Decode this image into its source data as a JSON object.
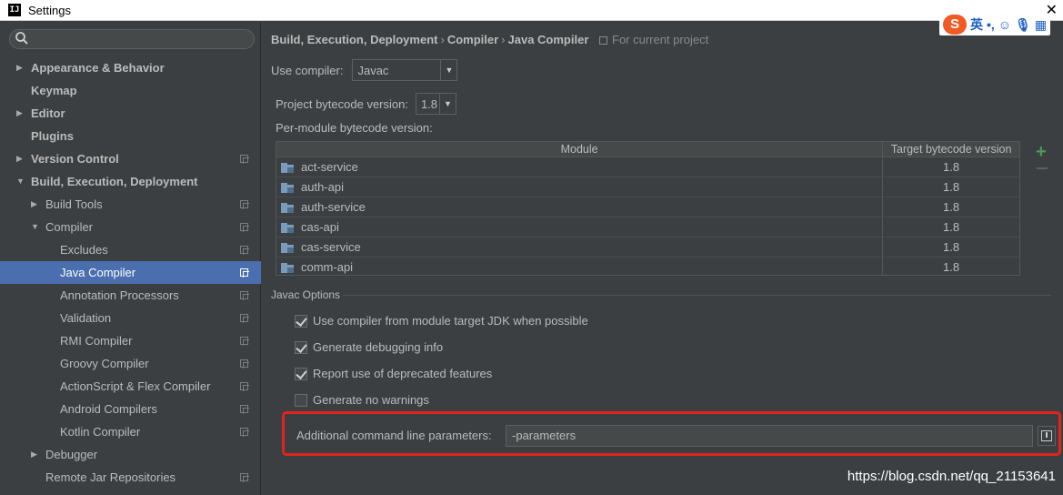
{
  "window": {
    "title": "Settings",
    "app_icon": "intellij-icon"
  },
  "ime": {
    "logo": "S",
    "mode": "英",
    "punct": "•,",
    "emoji_icon": "smiley-icon",
    "voice_icon": "microphone-icon",
    "menu_icon": "grid-icon"
  },
  "sidebar": {
    "search_placeholder": "",
    "items": [
      {
        "label": "Appearance & Behavior",
        "indent": 0,
        "arrow": "right",
        "bold": true,
        "proj": false
      },
      {
        "label": "Keymap",
        "indent": 0,
        "arrow": "",
        "bold": true,
        "proj": false
      },
      {
        "label": "Editor",
        "indent": 0,
        "arrow": "right",
        "bold": true,
        "proj": false
      },
      {
        "label": "Plugins",
        "indent": 0,
        "arrow": "",
        "bold": true,
        "proj": false
      },
      {
        "label": "Version Control",
        "indent": 0,
        "arrow": "right",
        "bold": true,
        "proj": true
      },
      {
        "label": "Build, Execution, Deployment",
        "indent": 0,
        "arrow": "down",
        "bold": true,
        "proj": false
      },
      {
        "label": "Build Tools",
        "indent": 1,
        "arrow": "right",
        "bold": false,
        "proj": true
      },
      {
        "label": "Compiler",
        "indent": 1,
        "arrow": "down",
        "bold": false,
        "proj": true
      },
      {
        "label": "Excludes",
        "indent": 2,
        "arrow": "",
        "bold": false,
        "proj": true
      },
      {
        "label": "Java Compiler",
        "indent": 2,
        "arrow": "",
        "bold": false,
        "proj": true,
        "selected": true
      },
      {
        "label": "Annotation Processors",
        "indent": 2,
        "arrow": "",
        "bold": false,
        "proj": true
      },
      {
        "label": "Validation",
        "indent": 2,
        "arrow": "",
        "bold": false,
        "proj": true
      },
      {
        "label": "RMI Compiler",
        "indent": 2,
        "arrow": "",
        "bold": false,
        "proj": true
      },
      {
        "label": "Groovy Compiler",
        "indent": 2,
        "arrow": "",
        "bold": false,
        "proj": true
      },
      {
        "label": "ActionScript & Flex Compiler",
        "indent": 2,
        "arrow": "",
        "bold": false,
        "proj": true
      },
      {
        "label": "Android Compilers",
        "indent": 2,
        "arrow": "",
        "bold": false,
        "proj": true
      },
      {
        "label": "Kotlin Compiler",
        "indent": 2,
        "arrow": "",
        "bold": false,
        "proj": true
      },
      {
        "label": "Debugger",
        "indent": 1,
        "arrow": "right",
        "bold": false,
        "proj": false
      },
      {
        "label": "Remote Jar Repositories",
        "indent": 1,
        "arrow": "",
        "bold": false,
        "proj": true
      }
    ]
  },
  "breadcrumb": {
    "items": [
      "Build, Execution, Deployment",
      "Compiler",
      "Java Compiler"
    ],
    "separator": "›",
    "scope": "For current project"
  },
  "compiler": {
    "label": "Use compiler:",
    "value": "Javac"
  },
  "bytecode": {
    "label": "Project bytecode version:",
    "value": "1.8"
  },
  "per_module": {
    "label": "Per-module bytecode version:",
    "columns": [
      "Module",
      "Target bytecode version"
    ],
    "rows": [
      {
        "module": "act-service",
        "target": "1.8"
      },
      {
        "module": "auth-api",
        "target": "1.8"
      },
      {
        "module": "auth-service",
        "target": "1.8"
      },
      {
        "module": "cas-api",
        "target": "1.8"
      },
      {
        "module": "cas-service",
        "target": "1.8"
      },
      {
        "module": "comm-api",
        "target": "1.8"
      }
    ],
    "add_label": "+"
  },
  "javac_options": {
    "title": "Javac Options",
    "checkboxes": [
      {
        "label": "Use compiler from module target JDK when possible",
        "checked": true
      },
      {
        "label": "Generate debugging info",
        "checked": true
      },
      {
        "label": "Report use of deprecated features",
        "checked": true
      },
      {
        "label": "Generate no warnings",
        "checked": false
      }
    ],
    "params_label": "Additional command line parameters:",
    "params_value": "-parameters",
    "highlight_color": "#e3231d"
  },
  "watermark": "https://blog.csdn.net/qq_21153641"
}
